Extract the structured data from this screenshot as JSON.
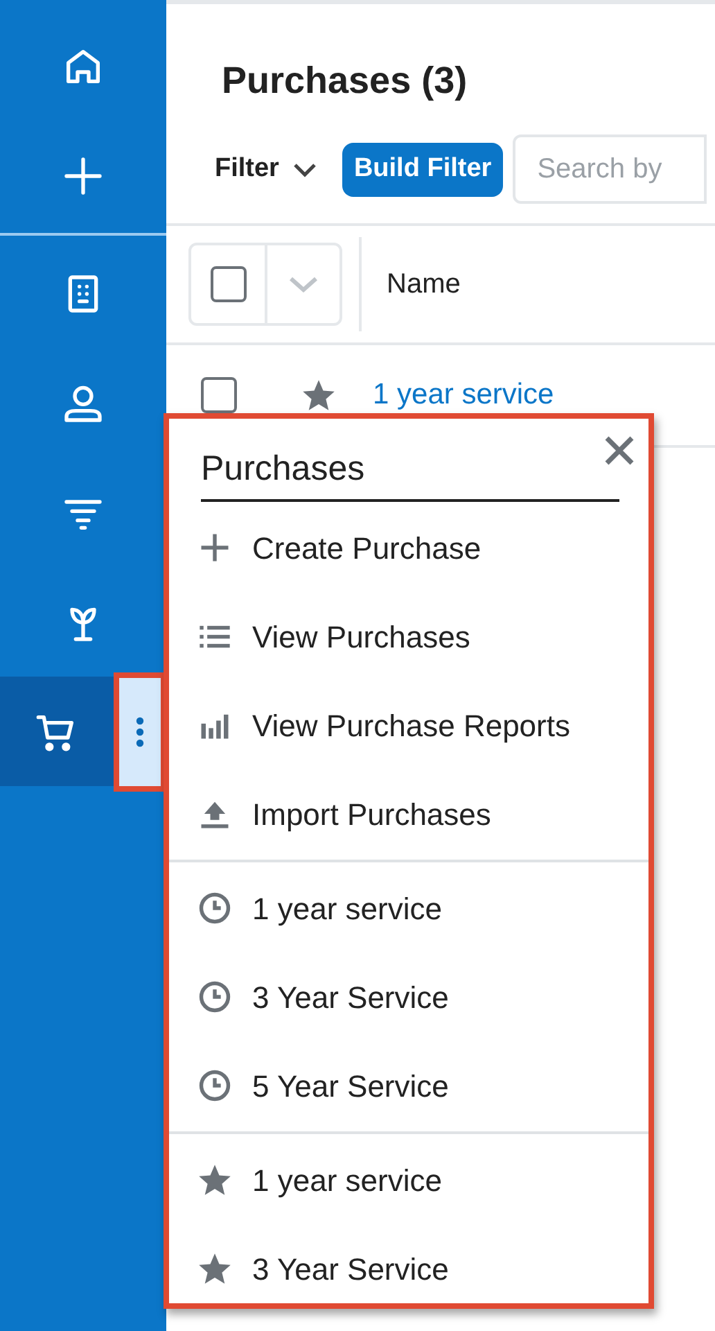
{
  "sidebar": {
    "items": [
      {
        "kind": "home",
        "selected": false
      },
      {
        "kind": "create",
        "selected": false
      },
      {
        "kind": "accounts",
        "selected": false
      },
      {
        "kind": "contacts",
        "selected": false
      },
      {
        "kind": "filter",
        "selected": false
      },
      {
        "kind": "plant",
        "selected": false
      },
      {
        "kind": "cart",
        "selected": true
      }
    ]
  },
  "header": {
    "title": "Purchases (3)"
  },
  "toolbar": {
    "filter_label": "Filter",
    "build_filter": "Build Filter",
    "search": {
      "placeholder": "Search by"
    }
  },
  "table": {
    "select_all": {
      "checked": false
    },
    "columns": [
      "Name"
    ],
    "rows": [
      {
        "name": "1 year service",
        "checked": false
      }
    ]
  },
  "menu": {
    "title": "Purchases",
    "sections": [
      {
        "items": [
          {
            "kind": "create",
            "label": "Create Purchase"
          },
          {
            "kind": "list",
            "label": "View Purchases"
          },
          {
            "kind": "reports",
            "label": "View Purchase Reports"
          },
          {
            "kind": "import",
            "label": "Import Purchases"
          }
        ]
      },
      {
        "items": [
          {
            "kind": "recent",
            "label": "1 year service"
          },
          {
            "kind": "recent",
            "label": "3 Year Service"
          },
          {
            "kind": "recent",
            "label": "5 Year Service"
          }
        ]
      },
      {
        "items": [
          {
            "kind": "favorite",
            "label": "1 year service"
          },
          {
            "kind": "favorite",
            "label": "3 Year Service"
          }
        ]
      }
    ]
  }
}
